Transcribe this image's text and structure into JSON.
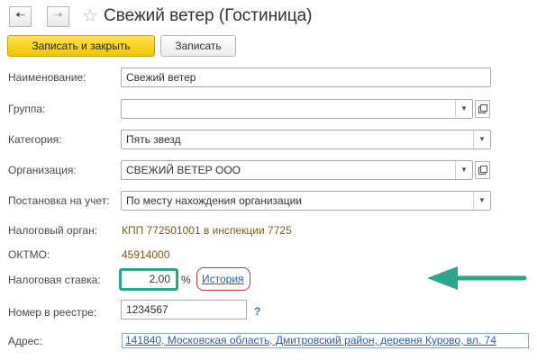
{
  "window": {
    "title": "Свежий ветер (Гостиница)",
    "back_icon": "arrow-left-icon",
    "forward_icon": "arrow-right-icon",
    "favorite_icon": "star-icon"
  },
  "toolbar": {
    "save_close_label": "Записать и закрыть",
    "save_label": "Записать"
  },
  "form": {
    "name": {
      "label": "Наименование:",
      "value": "Свежий ветер"
    },
    "group": {
      "label": "Группа:",
      "value": ""
    },
    "category": {
      "label": "Категория:",
      "value": "Пять звезд"
    },
    "organization": {
      "label": "Организация:",
      "value": "СВЕЖИЙ ВЕТЕР ООО"
    },
    "registration": {
      "label": "Постановка на учет:",
      "value": "По месту нахождения организации"
    },
    "tax_authority": {
      "label": "Налоговый орган:",
      "value": "КПП 772501001 в инспекции 7725"
    },
    "oktmo": {
      "label": "ОКТМО:",
      "value": "45914000"
    },
    "tax_rate": {
      "label": "Налоговая ставка:",
      "value": "2,00",
      "unit": "%",
      "history_link": "История"
    },
    "registry_number": {
      "label": "Номер в реестре:",
      "value": "1234567",
      "help": "?"
    },
    "address": {
      "label": "Адрес:",
      "value": "141840, Московская область, Дмитровский район, деревня Курово, вл. 74"
    }
  },
  "annotation": {
    "arrow_color": "#2aa78a",
    "highlight_color": "#2aa78a",
    "history_highlight_color": "#c0393b"
  },
  "colors": {
    "primary_button": "#f2c500",
    "link": "#2b5fa9",
    "value_brown": "#7a5a1e"
  }
}
